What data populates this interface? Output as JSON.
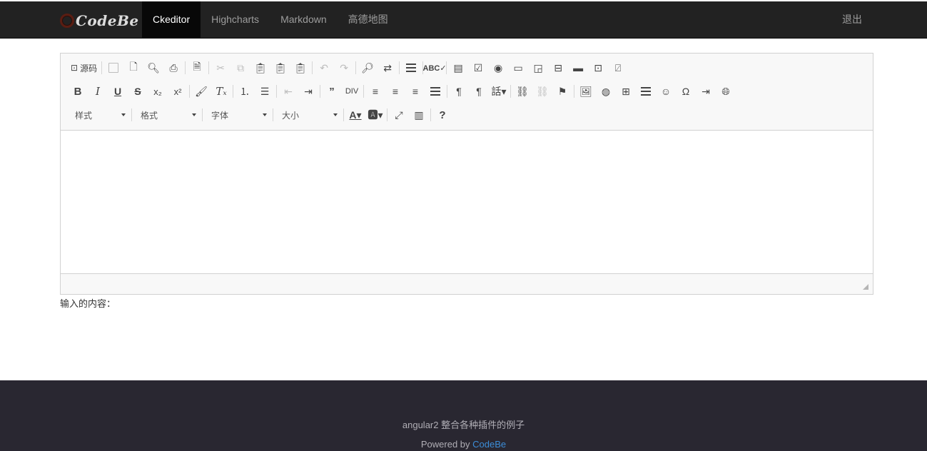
{
  "brand": {
    "name": "CodeBe"
  },
  "nav": {
    "items": [
      "Ckeditor",
      "Highcharts",
      "Markdown",
      "高德地图"
    ],
    "active": "Ckeditor",
    "logout": "退出"
  },
  "editor": {
    "source_label": "源码",
    "combos": {
      "styles": "样式",
      "format": "格式",
      "font": "字体",
      "size": "大小"
    },
    "toolbar_help": "?",
    "omega": "Ω"
  },
  "output": {
    "label": "输入的内容："
  },
  "footer": {
    "line1": "angular2 整合各种插件的例子",
    "powered_prefix": "Powered by ",
    "powered_link": "CodeBe"
  },
  "colors": {
    "navbar": "#222222",
    "active_nav": "#080808",
    "footer": "#292731",
    "link": "#3c8dd8"
  }
}
